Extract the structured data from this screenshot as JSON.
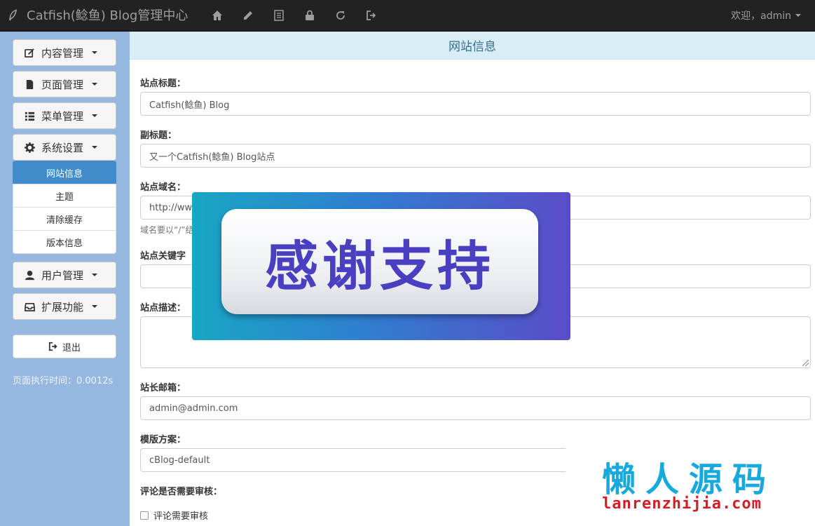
{
  "navbar": {
    "brand_icon": "feather-icon",
    "brand": "Catfish(鲶鱼) Blog管理中心",
    "icons": [
      "home-icon",
      "pencil-icon",
      "list-icon",
      "lock-icon",
      "refresh-icon",
      "logout-icon"
    ],
    "user_label": "欢迎，admin"
  },
  "sidebar": {
    "menus": [
      {
        "label": "内容管理",
        "icon": "edit-icon"
      },
      {
        "label": "页面管理",
        "icon": "file-icon"
      },
      {
        "label": "菜单管理",
        "icon": "list-icon"
      },
      {
        "label": "系统设置",
        "icon": "gear-icon"
      },
      {
        "label": "用户管理",
        "icon": "user-icon"
      },
      {
        "label": "扩展功能",
        "icon": "inbox-icon"
      }
    ],
    "submenu": [
      "网站信息",
      "主题",
      "清除缓存",
      "版本信息"
    ],
    "active_submenu": "网站信息",
    "logout": "退出",
    "exec_time": "页面执行时间：0.0012s"
  },
  "main": {
    "panel_title": "网站信息",
    "site_title": {
      "label": "站点标题：",
      "value": "Catfish(鲶鱼) Blog"
    },
    "subtitle": {
      "label": "副标题：",
      "value": "又一个Catfish(鲶鱼) Blog站点"
    },
    "domain": {
      "label": "站点域名：",
      "value": "http://www",
      "help": "域名要以“/”结"
    },
    "keywords": {
      "label": "站点关键字",
      "value": ""
    },
    "description": {
      "label": "站点描述：",
      "value": ""
    },
    "email": {
      "label": "站长邮箱：",
      "value": "admin@admin.com"
    },
    "template": {
      "label": "模版方案：",
      "value": "cBlog-default"
    },
    "comment_review": {
      "label": "评论是否需要审核：",
      "checkbox_label": "评论需要审核",
      "checked": false
    }
  },
  "overlay": {
    "thanks": "感谢支持",
    "watermark_cn": "懒人源码",
    "watermark_en": "lanrenzhijia.com"
  },
  "colors": {
    "navbar_bg": "#222222",
    "sidebar_bg": "#96b7e0",
    "active_item": "#428bca",
    "panel_head_bg": "#d9edf7",
    "thanks_text": "#4a3fc0",
    "watermark_cn": "#17a9dc",
    "watermark_en": "#d21e26"
  }
}
